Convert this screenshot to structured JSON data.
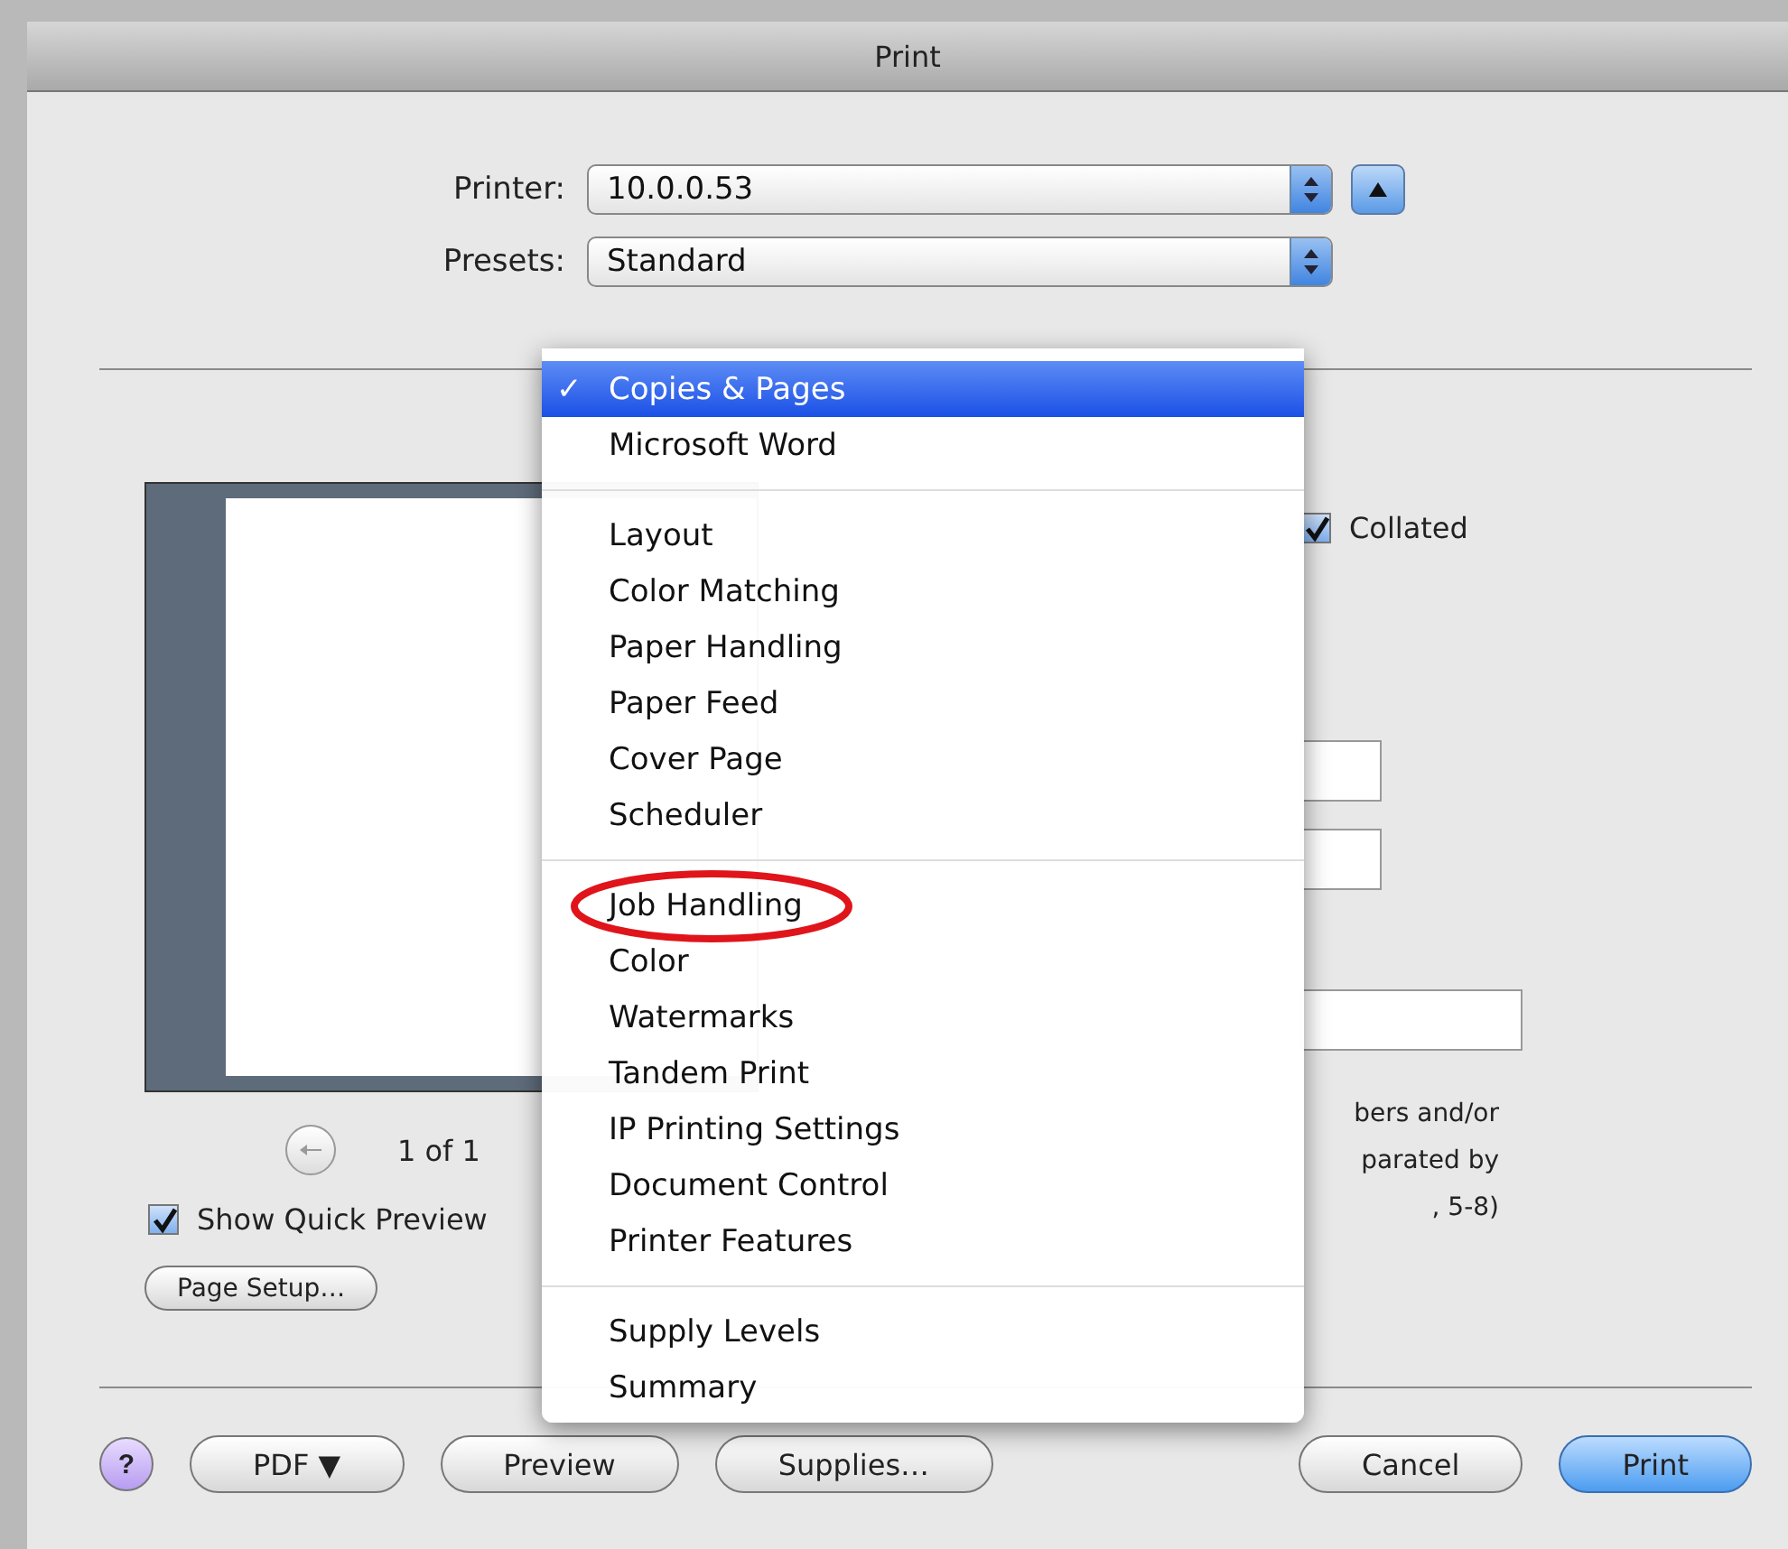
{
  "window": {
    "title": "Print"
  },
  "printer": {
    "label": "Printer:",
    "value": "10.0.0.53"
  },
  "presets": {
    "label": "Presets:",
    "value": "Standard"
  },
  "preview": {
    "page_indicator": "1 of 1"
  },
  "show_quick_preview": {
    "label": "Show Quick Preview",
    "checked": true
  },
  "page_setup_button": "Page Setup…",
  "collated": {
    "label": "Collated",
    "checked": true
  },
  "page_range_hint": [
    "bers and/or",
    "parated by",
    ", 5-8)"
  ],
  "menu": {
    "items": [
      {
        "kind": "item",
        "label": "Copies & Pages",
        "check": "✓",
        "selected": true,
        "annotated": false
      },
      {
        "kind": "item",
        "label": "Microsoft Word",
        "selected": false,
        "annotated": false
      },
      {
        "kind": "separator"
      },
      {
        "kind": "item",
        "label": "Layout",
        "selected": false,
        "annotated": false
      },
      {
        "kind": "item",
        "label": "Color Matching",
        "selected": false,
        "annotated": false
      },
      {
        "kind": "item",
        "label": "Paper Handling",
        "selected": false,
        "annotated": false
      },
      {
        "kind": "item",
        "label": "Paper Feed",
        "selected": false,
        "annotated": false
      },
      {
        "kind": "item",
        "label": "Cover Page",
        "selected": false,
        "annotated": false
      },
      {
        "kind": "item",
        "label": "Scheduler",
        "selected": false,
        "annotated": false
      },
      {
        "kind": "separator"
      },
      {
        "kind": "item",
        "label": "Job Handling",
        "selected": false,
        "annotated": true
      },
      {
        "kind": "item",
        "label": "Color",
        "selected": false,
        "annotated": false
      },
      {
        "kind": "item",
        "label": "Watermarks",
        "selected": false,
        "annotated": false
      },
      {
        "kind": "item",
        "label": "Tandem Print",
        "selected": false,
        "annotated": false
      },
      {
        "kind": "item",
        "label": "IP Printing Settings",
        "selected": false,
        "annotated": false
      },
      {
        "kind": "item",
        "label": "Document Control",
        "selected": false,
        "annotated": false
      },
      {
        "kind": "item",
        "label": "Printer Features",
        "selected": false,
        "annotated": false
      },
      {
        "kind": "separator"
      },
      {
        "kind": "item",
        "label": "Supply Levels",
        "selected": false,
        "annotated": false
      },
      {
        "kind": "item",
        "label": "Summary",
        "selected": false,
        "annotated": false
      }
    ]
  },
  "buttons": [
    {
      "kind": "help",
      "label": "?"
    },
    {
      "kind": "plain",
      "label": "PDF ▼"
    },
    {
      "kind": "plain",
      "label": "Preview"
    },
    {
      "kind": "plain",
      "label": "Supplies…"
    },
    {
      "kind": "spacer"
    },
    {
      "kind": "plain",
      "label": "Cancel"
    },
    {
      "kind": "default",
      "label": "Print"
    }
  ]
}
